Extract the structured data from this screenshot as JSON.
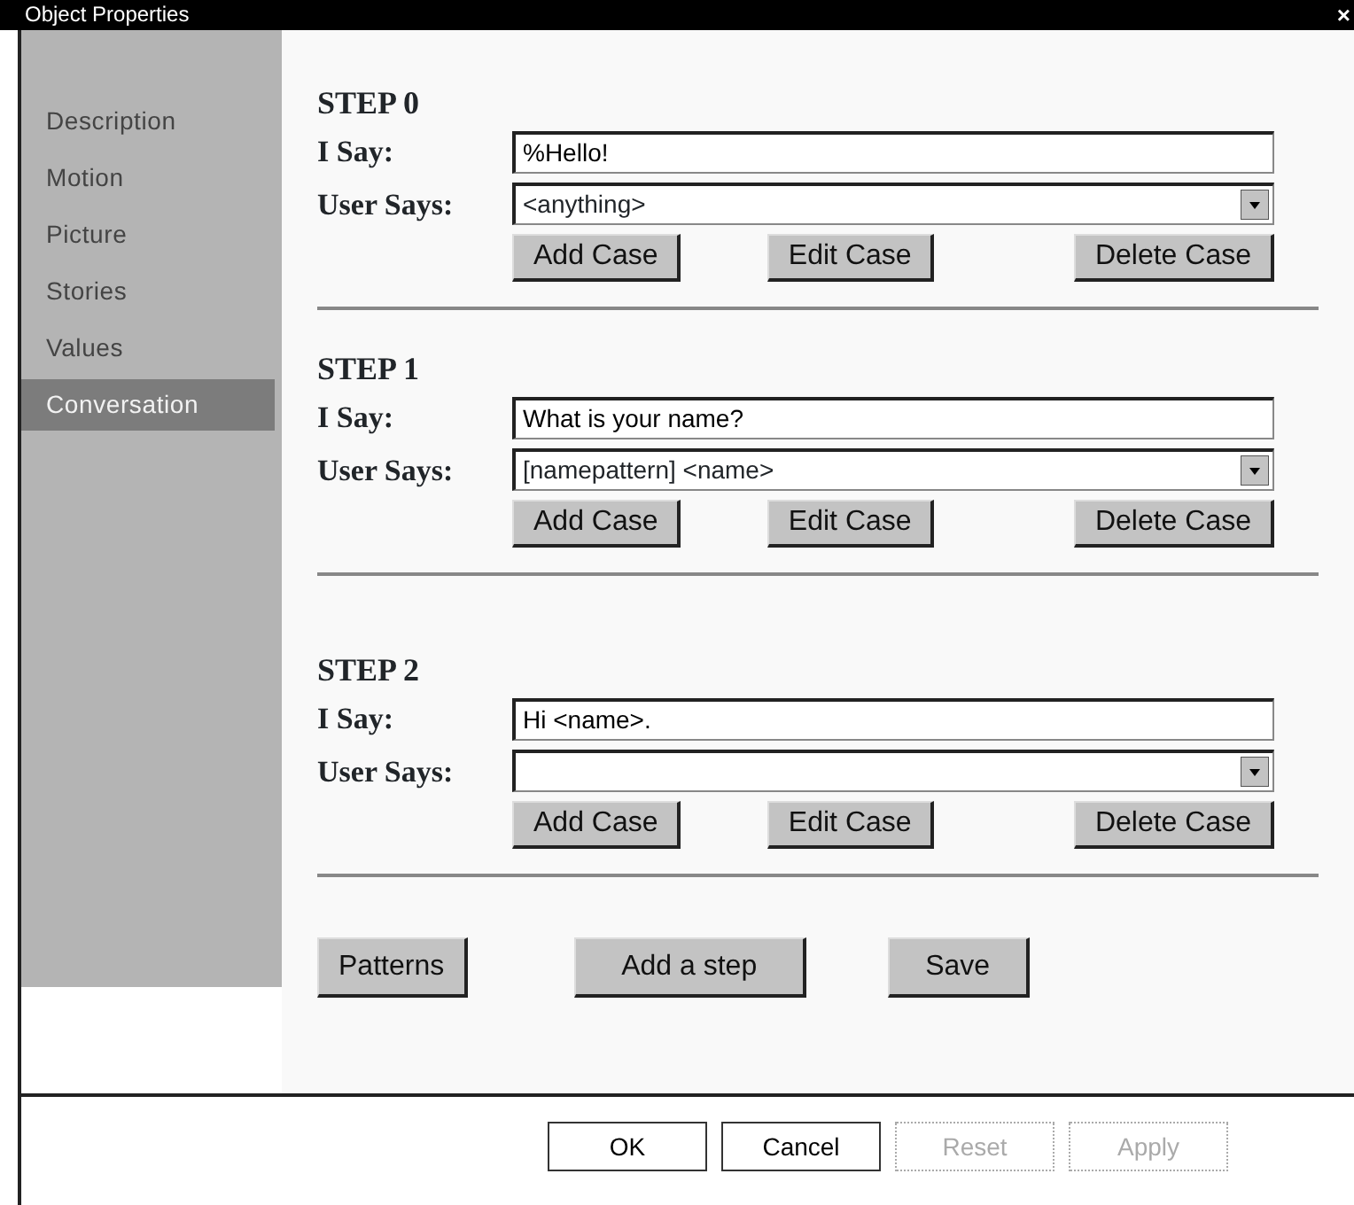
{
  "window": {
    "title": "Object Properties",
    "close": "×"
  },
  "sidebar": {
    "items": [
      {
        "label": "Description",
        "selected": false
      },
      {
        "label": "Motion",
        "selected": false
      },
      {
        "label": "Picture",
        "selected": false
      },
      {
        "label": "Stories",
        "selected": false
      },
      {
        "label": "Values",
        "selected": false
      },
      {
        "label": "Conversation",
        "selected": true
      }
    ]
  },
  "steps": [
    {
      "title": "STEP 0",
      "i_say_label": "I Say:",
      "i_say": "%Hello!",
      "user_says_label": "User Says:",
      "user_says": "<anything>",
      "buttons": [
        "Add Case",
        "Edit Case",
        "Delete Case"
      ]
    },
    {
      "title": "STEP 1",
      "i_say_label": "I Say:",
      "i_say": "What is your name?",
      "user_says_label": "User Says:",
      "user_says": "[namepattern] <name>",
      "buttons": [
        "Add Case",
        "Edit Case",
        "Delete Case"
      ]
    },
    {
      "title": "STEP 2",
      "i_say_label": "I Say:",
      "i_say": "Hi <name>.",
      "user_says_label": "User Says:",
      "buttons": [
        "Add Case",
        "Edit Case",
        "Delete Case"
      ]
    }
  ],
  "actions": [
    "Patterns",
    "Add a step",
    "Save"
  ],
  "dialog_buttons": [
    {
      "label": "OK",
      "disabled": false
    },
    {
      "label": "Cancel",
      "disabled": false
    },
    {
      "label": "Reset",
      "disabled": true
    },
    {
      "label": "Apply",
      "disabled": true
    }
  ]
}
